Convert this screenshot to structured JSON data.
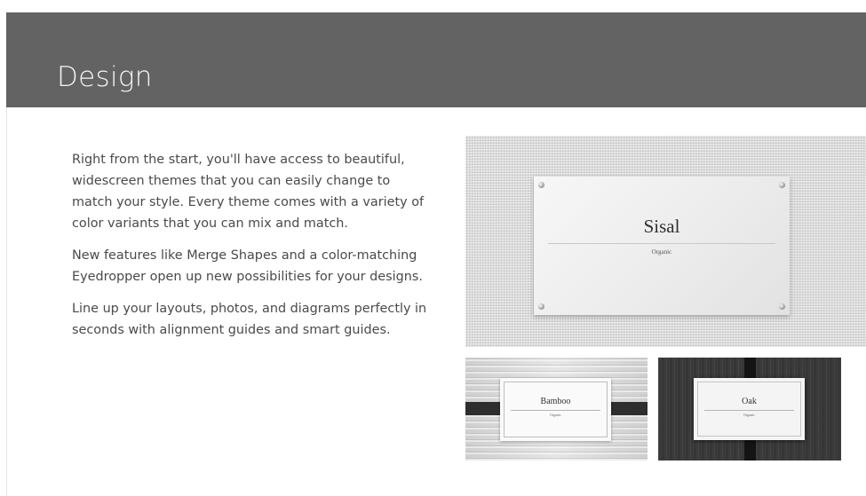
{
  "header": {
    "title": "Design"
  },
  "content": {
    "paragraphs": [
      "Right from the start, you'll have access to beautiful, widescreen themes that you can easily change to match your style.  Every theme comes with a variety of color variants that you can mix and match.",
      "New features like Merge Shapes and a  color-matching Eyedropper open up new possibilities for your designs.",
      "Line up your layouts, photos, and diagrams perfectly in seconds with alignment guides and smart guides."
    ]
  },
  "themes": {
    "sisal": {
      "title": "Sisal",
      "subtitle": "Organic"
    },
    "bamboo": {
      "title": "Bamboo",
      "subtitle": "Organic"
    },
    "oak": {
      "title": "Oak",
      "subtitle": "Organic"
    }
  },
  "colors": {
    "header_bg": "#636363",
    "header_text": "#f4f4f4",
    "body_text": "#4a4a4a"
  }
}
